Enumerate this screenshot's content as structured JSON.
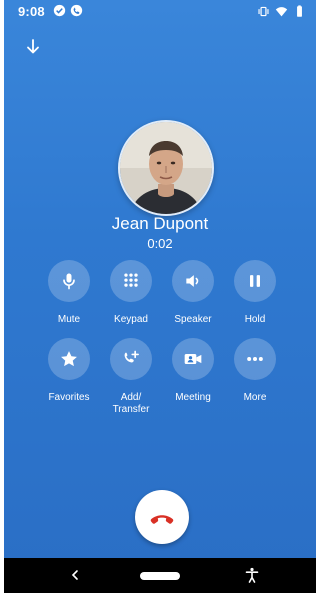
{
  "status_bar": {
    "time": "9:08",
    "left_icons": [
      "check-circle-icon",
      "phone-circle-icon"
    ],
    "right_icons": [
      "vibrate-icon",
      "wifi-icon",
      "battery-icon"
    ]
  },
  "header": {
    "minimize_icon": "arrow-down-icon"
  },
  "caller": {
    "name": "Jean Dupont",
    "timer": "0:02"
  },
  "controls": [
    {
      "label": "Mute",
      "icon": "microphone-icon"
    },
    {
      "label": "Keypad",
      "icon": "dialpad-icon"
    },
    {
      "label": "Speaker",
      "icon": "speaker-icon"
    },
    {
      "label": "Hold",
      "icon": "pause-icon"
    },
    {
      "label": "Favorites",
      "icon": "star-icon"
    },
    {
      "label": "Add/\nTransfer",
      "icon": "add-call-icon"
    },
    {
      "label": "Meeting",
      "icon": "video-camera-icon"
    },
    {
      "label": "More",
      "icon": "more-dots-icon"
    }
  ],
  "end_call": {
    "icon": "hang-up-icon",
    "color": "#d93025"
  },
  "nav_bar": {
    "back_icon": "chevron-left-icon",
    "home": "home-pill",
    "a11y_icon": "accessibility-icon"
  },
  "colors": {
    "background": "#2f79d0",
    "button_bg": "rgba(255,255,255,0.22)",
    "hangup": "#d93025"
  }
}
